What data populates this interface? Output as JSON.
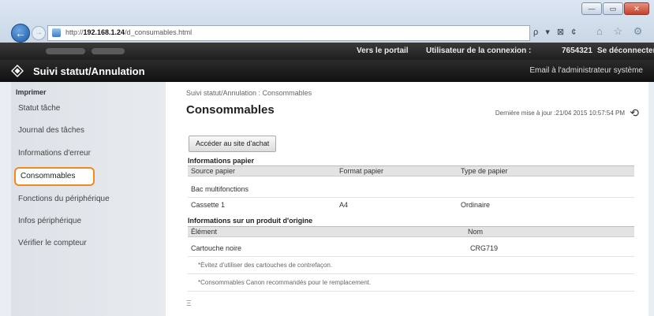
{
  "browser": {
    "url_prefix": "http://",
    "url_host": "192.168.1.24",
    "url_path": "/d_consumables.html",
    "addr_tools": "ρ ▾ ⊠ ¢",
    "nav_icons": "⌂ ☆ ⚙",
    "win_minimize": "—",
    "win_maximize": "▭",
    "win_close": "✕"
  },
  "topbar": {
    "portal_link": "Vers le portail",
    "user_label": "Utilisateur de la connexion :",
    "user_id": "7654321",
    "logout_link": "Se déconnecter"
  },
  "titlebar": {
    "title": "Suivi statut/Annulation",
    "mail_link": "Email à l'administrateur système"
  },
  "sidebar": {
    "section_heading": "Imprimer",
    "items": [
      {
        "label": "Statut tâche"
      },
      {
        "label": "Journal des tâches"
      },
      {
        "label": "Informations d'erreur"
      },
      {
        "label": "Consommables",
        "active": true
      },
      {
        "label": "Fonctions du périphérique"
      },
      {
        "label": "Infos périphérique"
      },
      {
        "label": "Vérifier le compteur"
      }
    ]
  },
  "content": {
    "breadcrumb": "Suivi statut/Annulation : Consommables",
    "page_title": "Consommables",
    "last_updated": "Dernière mise à jour :21/04 2015 10:57:54 PM",
    "buy_button": "Accéder au site d'achat",
    "paper_section": {
      "title": "Informations papier",
      "headers": [
        "Source papier",
        "Format papier",
        "Type de papier"
      ],
      "rows": [
        [
          "Bac multifonctions",
          "",
          ""
        ],
        [
          "Cassette 1",
          "A4",
          "Ordinaire"
        ]
      ]
    },
    "supply_section": {
      "title": "Informations sur un produit d'origine",
      "headers": [
        "Élément",
        "Nom"
      ],
      "rows": [
        [
          "Cartouche noire",
          "CRG719"
        ]
      ]
    },
    "notes": [
      "*Évitez d'utiliser des cartouches de contrefaçon.",
      "*Consommables Canon recommandés pour le remplacement."
    ],
    "to_top": "Ξ"
  },
  "colors": {
    "active_outline": "#f08a1f",
    "header_bg": "#1e1e1e"
  }
}
